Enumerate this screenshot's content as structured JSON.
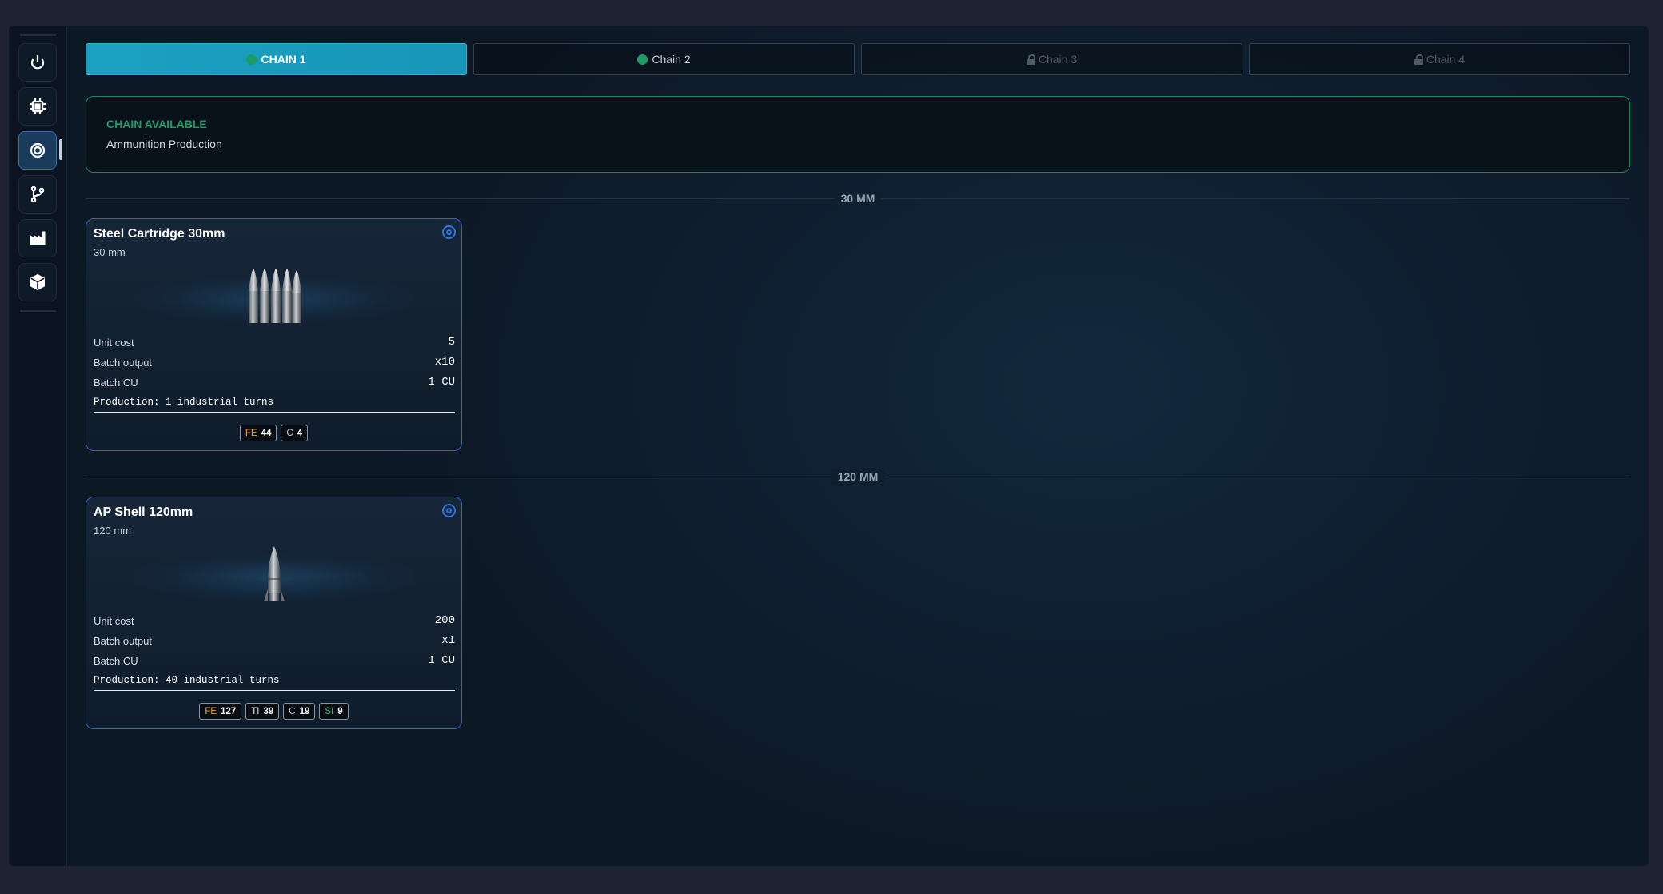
{
  "nav": {
    "items": [
      {
        "icon": "power-icon",
        "active": false
      },
      {
        "icon": "chip-icon",
        "active": false
      },
      {
        "icon": "target-icon",
        "active": true
      },
      {
        "icon": "branch-icon",
        "active": false
      },
      {
        "icon": "factory-icon",
        "active": false
      },
      {
        "icon": "cube-icon",
        "active": false
      }
    ]
  },
  "tabs": [
    {
      "label": "CHAIN 1",
      "state": "active",
      "status": "available"
    },
    {
      "label": "Chain 2",
      "state": "normal",
      "status": "available"
    },
    {
      "label": "Chain 3",
      "state": "locked",
      "status": "locked"
    },
    {
      "label": "Chain 4",
      "state": "locked",
      "status": "locked"
    }
  ],
  "banner": {
    "title": "CHAIN AVAILABLE",
    "subtitle": "Ammunition Production"
  },
  "sections": [
    {
      "label": "30 MM",
      "items": [
        {
          "name": "Steel Cartridge 30mm",
          "caliber": "30 mm",
          "stats": [
            {
              "label": "Unit cost",
              "value": "5"
            },
            {
              "label": "Batch output",
              "value": "x10"
            },
            {
              "label": "Batch CU",
              "value": "1 CU"
            }
          ],
          "production": "Production: 1 industrial turns",
          "resources": [
            {
              "sym": "FE",
              "amount": "44"
            },
            {
              "sym": "C",
              "amount": "4"
            }
          ]
        }
      ]
    },
    {
      "label": "120 MM",
      "items": [
        {
          "name": "AP Shell 120mm",
          "caliber": "120 mm",
          "stats": [
            {
              "label": "Unit cost",
              "value": "200"
            },
            {
              "label": "Batch output",
              "value": "x1"
            },
            {
              "label": "Batch CU",
              "value": "1 CU"
            }
          ],
          "production": "Production: 40 industrial turns",
          "resources": [
            {
              "sym": "FE",
              "amount": "127"
            },
            {
              "sym": "TI",
              "amount": "39"
            },
            {
              "sym": "C",
              "amount": "19"
            },
            {
              "sym": "SI",
              "amount": "9"
            }
          ]
        }
      ]
    }
  ],
  "colors": {
    "accent": "#1aa1c1",
    "available": "#1b9d63",
    "card_border": "#2a66c8",
    "fe": "#f0a43a",
    "si": "#38c178"
  }
}
